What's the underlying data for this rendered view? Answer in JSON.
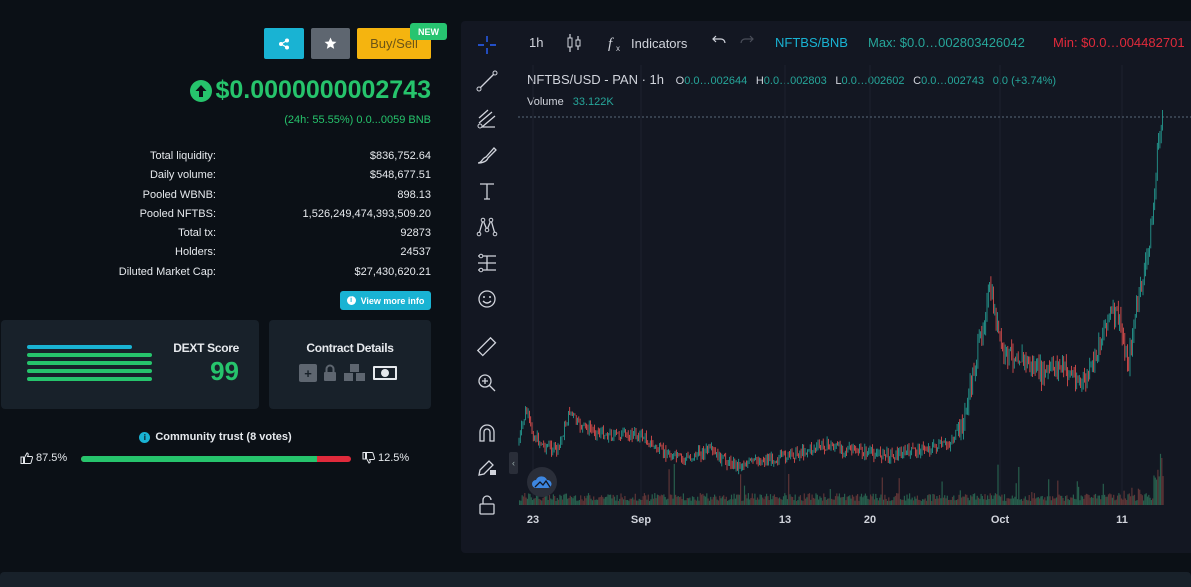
{
  "header": {
    "buy_sell_label": "Buy/Sell",
    "new_badge": "NEW"
  },
  "price": {
    "value": "$0.0000000002743",
    "change_24h": "(24h: 55.55%) 0.0...0059 BNB"
  },
  "stats": [
    {
      "label": "Total liquidity:",
      "value": "$836,752.64"
    },
    {
      "label": "Daily volume:",
      "value": "$548,677.51"
    },
    {
      "label": "Pooled WBNB:",
      "value": "898.13"
    },
    {
      "label": "Pooled NFTBS:",
      "value": "1,526,249,474,393,509.20"
    },
    {
      "label": "Total tx:",
      "value": "92873"
    },
    {
      "label": "Holders:",
      "value": "24537"
    },
    {
      "label": "Diluted Market Cap:",
      "value": "$27,430,620.21"
    }
  ],
  "view_more_label": "View more info",
  "dext": {
    "title": "DEXT Score",
    "score": "99"
  },
  "contract": {
    "title": "Contract Details"
  },
  "community": {
    "title": "Community trust (8 votes)",
    "up_pct": "87.5%",
    "down_pct": "12.5%",
    "up_fraction": 0.875
  },
  "chart": {
    "interval": "1h",
    "indicators_label": "Indicators",
    "pair": "NFTBS/BNB",
    "max_label": "Max: $0.0…002803426042",
    "min_label": "Min: $0.0…004482701",
    "symbol": "NFTBS/USD - PAN · 1h",
    "ohlc": [
      {
        "k": "O",
        "v": "0.0…002644"
      },
      {
        "k": "H",
        "v": "0.0…002803"
      },
      {
        "k": "L",
        "v": "0.0…002602"
      },
      {
        "k": "C",
        "v": "0.0…002743"
      }
    ],
    "change": "0.0 (+3.74%)",
    "volume_label": "Volume",
    "volume_value": "33.122K",
    "x_labels": [
      "23",
      "Sep",
      "13",
      "20",
      "Oct",
      "11"
    ]
  },
  "colors": {
    "up": "#26a69a",
    "down": "#ef5350",
    "accent": "#19b3d3",
    "green": "#26c46c"
  }
}
